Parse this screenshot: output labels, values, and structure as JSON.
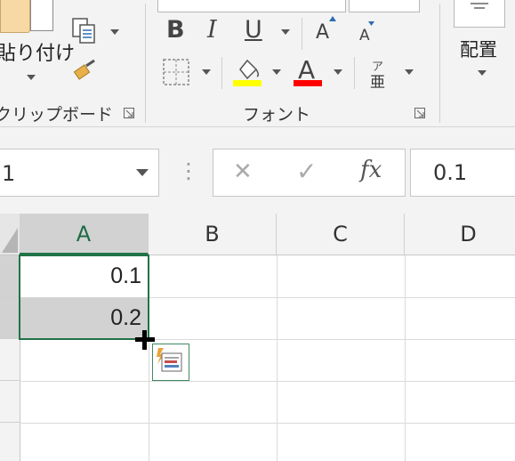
{
  "ribbon": {
    "clipboard": {
      "paste_label": "貼り付け",
      "group_label": "クリップボード"
    },
    "font": {
      "bold": "B",
      "italic": "I",
      "underline": "U",
      "grow_font": "A",
      "shrink_font": "A",
      "font_color_glyph": "A",
      "phonetic_top": "ア",
      "phonetic_bottom": "亜",
      "group_label": "フォント"
    },
    "alignment": {
      "label": "配置"
    },
    "colors": {
      "highlight": "#ffff00",
      "font_color": "#ff0000"
    }
  },
  "formula_bar": {
    "name_box_value": "1",
    "fx_label": "fx",
    "cancel_glyph": "✕",
    "enter_glyph": "✓",
    "separator_glyph": "⋮",
    "formula_value": "0.1"
  },
  "grid": {
    "columns": [
      "A",
      "B",
      "C",
      "D"
    ],
    "selected_column": "A",
    "cells": [
      {
        "col": "A",
        "row": 1,
        "value": "0.1"
      },
      {
        "col": "A",
        "row": 2,
        "value": "0.2"
      }
    ],
    "accent": "#217346"
  },
  "cursor": {
    "icon": "crosshair-fill-handle-icon"
  },
  "quick_analysis": {
    "icon": "quick-analysis-icon"
  }
}
